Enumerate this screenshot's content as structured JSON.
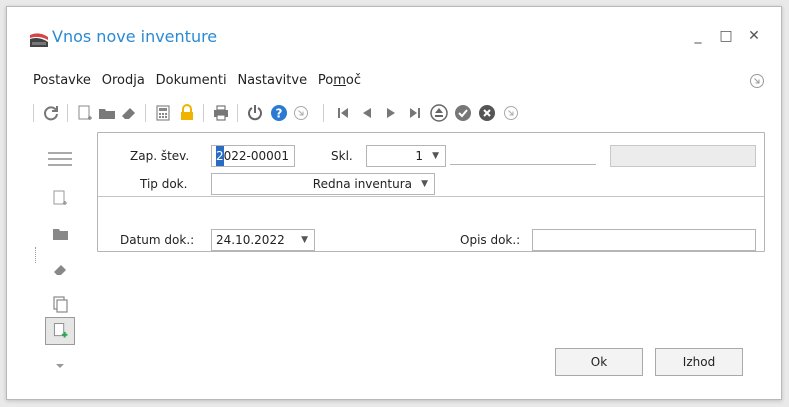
{
  "window": {
    "title": "Vnos nove inventure",
    "minimize_glyph": "_",
    "maximize_glyph": "□",
    "close_glyph": "✕"
  },
  "menu": {
    "items": [
      "Postavke",
      "Orodja",
      "Dokumenti",
      "Nastavitve"
    ],
    "help_prefix": "Po",
    "help_underlined": "m",
    "help_suffix": "oč"
  },
  "form": {
    "zap_label": "Zap. štev.",
    "zap_caret": "2",
    "zap_rest": "022-00001",
    "skl_label": "Skl.",
    "skl_value": "1",
    "tip_label": "Tip dok.",
    "tip_value": "Redna inventura",
    "datum_label": "Datum dok.:",
    "datum_value": "24.10.2022",
    "opis_label": "Opis dok.:",
    "opis_value": ""
  },
  "buttons": {
    "ok": "Ok",
    "exit": "Izhod"
  },
  "colors": {
    "accent": "#2a8ad4",
    "help_blue": "#2a7ad4",
    "lock_yellow": "#f0b400",
    "add_green": "#2da84a"
  }
}
